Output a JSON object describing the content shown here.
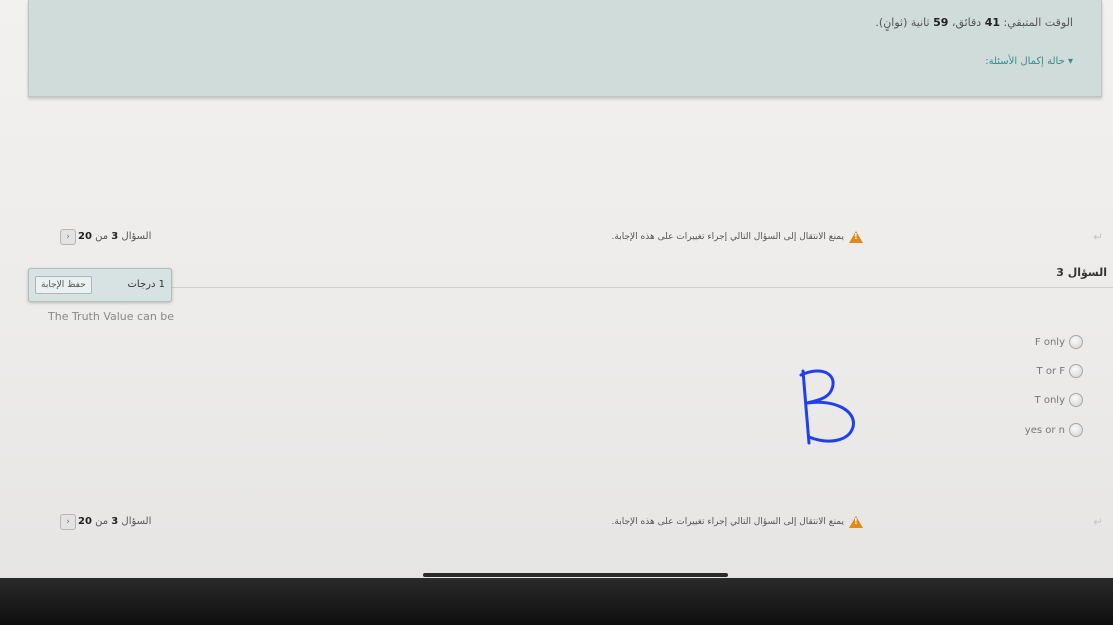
{
  "timer": {
    "label": "الوقت المتبقي:",
    "minutes": "41",
    "minutes_unit": "دقائق،",
    "seconds": "59",
    "seconds_unit": "ثانية (ثوانٍ)."
  },
  "completion_link": "حالة إكمال الأسئلة:",
  "navigation": {
    "warning": "يمنع الانتقال إلى السؤال التالي إجراء تغييرات على هذه الإجابة.",
    "counter_prefix": "السؤال",
    "current": "3",
    "counter_of": "من",
    "total": "20",
    "next_icon": "chevron-right-icon"
  },
  "question": {
    "title": "السؤال 3",
    "points": "1 درجات",
    "save_label": "حفظ الإجابة",
    "text": "The Truth Value can be",
    "options": [
      "F only",
      "T or F",
      "T only",
      "yes or n"
    ]
  },
  "annotation": {
    "letter": "B",
    "color": "#1f3ff0"
  },
  "colors": {
    "panel": "#cfdcda",
    "link": "#3a8a8e",
    "warning": "#e08a1b"
  }
}
